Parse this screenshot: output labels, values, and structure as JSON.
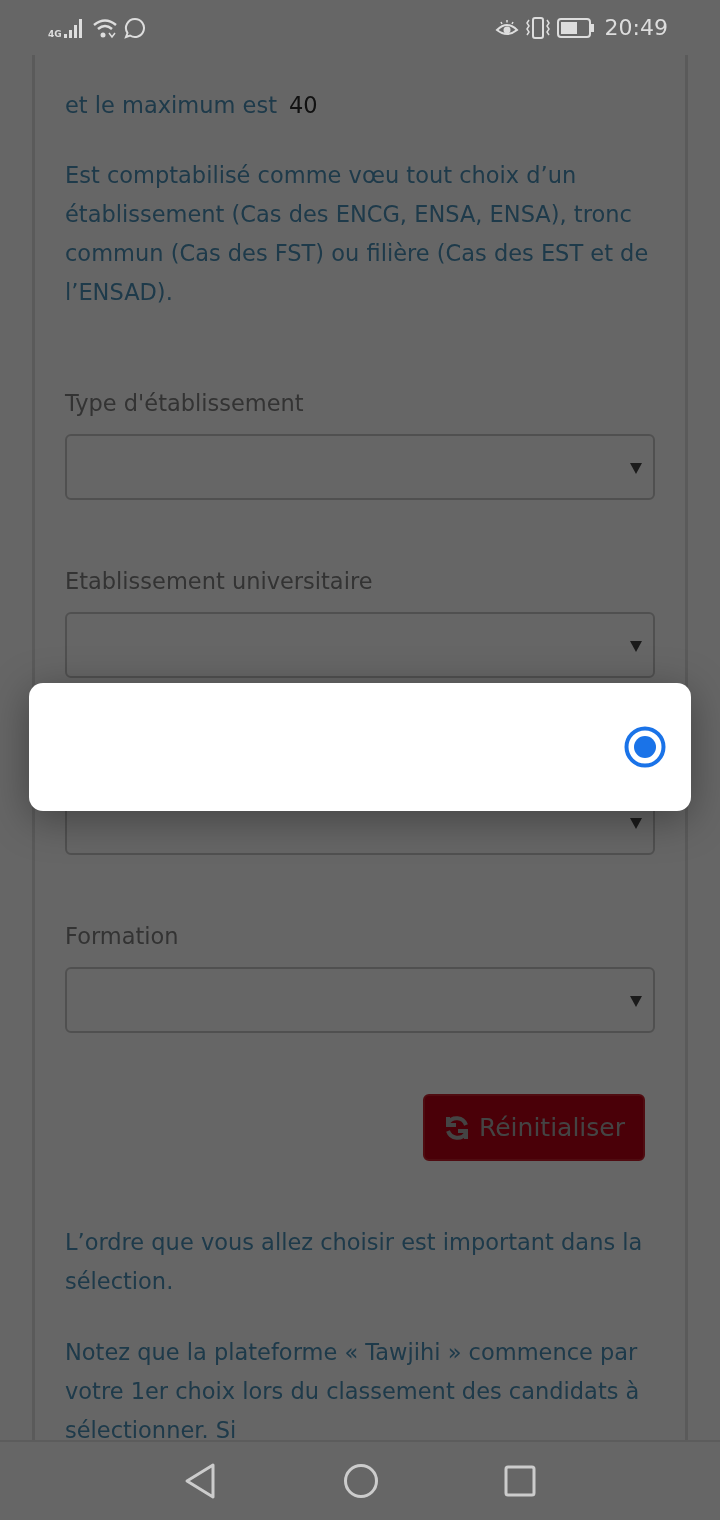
{
  "status_bar": {
    "network": "4G",
    "time": "20:49"
  },
  "intro": {
    "text": "et le maximum est",
    "value": "40"
  },
  "notice": "Est comptabilisé comme vœu tout choix d’un établissement (Cas des ENCG, ENSA, ENSA), tronc commun (Cas des FST) ou filière (Cas des EST et de l’ENSAD).",
  "fields": [
    {
      "kind": "select",
      "label": "Type d'établissement"
    },
    {
      "kind": "select",
      "label": "Etablissement universitaire"
    },
    {
      "kind": "select"
    },
    {
      "kind": "select",
      "label": "Formation"
    }
  ],
  "reset_button": {
    "label": "Réinitialiser"
  },
  "paragraphs": [
    "L’ordre que vous allez choisir est important dans la sélection.",
    "Notez que la plateforme « Tawjihi » commence par votre 1er choix lors du classement des candidats à sélectionner. Si"
  ],
  "dialog": {
    "options": [
      {
        "selected": true
      }
    ]
  }
}
